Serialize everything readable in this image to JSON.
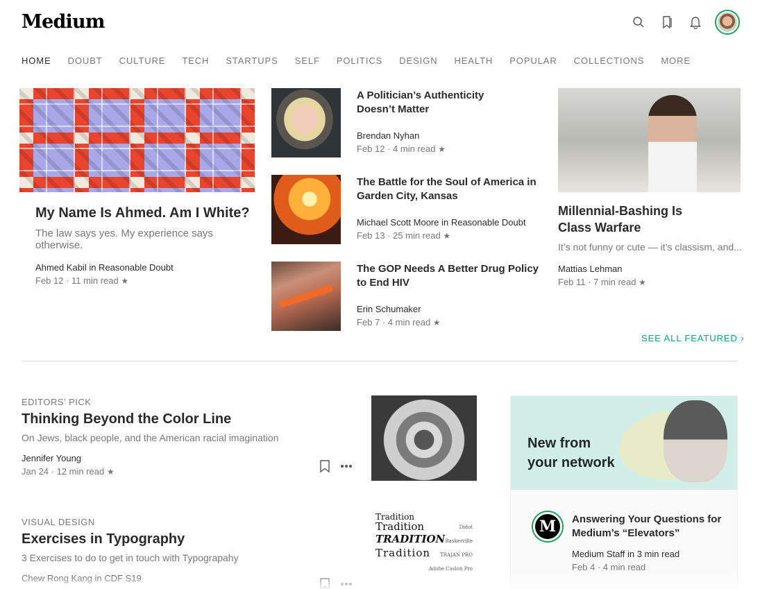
{
  "header": {
    "logo": "Medium",
    "icons": [
      "search-icon",
      "bookmarks-icon",
      "notifications-icon"
    ],
    "accent": "#1aa45c"
  },
  "nav": [
    "HOME",
    "DOUBT",
    "CULTURE",
    "TECH",
    "STARTUPS",
    "SELF",
    "POLITICS",
    "DESIGN",
    "HEALTH",
    "POPULAR",
    "COLLECTIONS",
    "MORE"
  ],
  "featured": {
    "main": {
      "title": "My Name Is Ahmed. Am I White?",
      "subtitle": "The law says yes. My experience says otherwise.",
      "author": "Ahmed Kabil in Reasonable Doubt",
      "meta": "Feb 12 · 11 min read"
    },
    "list": [
      {
        "title": "A Politician’s Authenticity Doesn’t Matter",
        "author": "Brendan Nyhan",
        "meta": "Feb 12 · 4 min read"
      },
      {
        "title": "The Battle for the Soul of America in Garden City, Kansas",
        "author": "Michael Scott Moore in Reasonable Doubt",
        "meta": "Feb 13 · 25 min read"
      },
      {
        "title": "The GOP Needs A Better Drug Policy to End HIV",
        "author": "Erin Schumaker",
        "meta": "Feb 7 · 4 min read"
      }
    ],
    "right": {
      "title": "Millennial-Bashing Is Class Warfare",
      "subtitle": "It’s not funny or cute — it’s classism, and...",
      "author": "Mattias Lehman",
      "meta": "Feb 11 · 7 min read"
    },
    "see_all": "SEE ALL FEATURED"
  },
  "star": "★",
  "feed": [
    {
      "kicker": "EDITORS’ PICK",
      "title": "Thinking Beyond the Color Line",
      "subtitle": "On Jews, black people, and the American racial imagination",
      "author": "Jennifer Young",
      "meta": "Jan 24 · 12 min read"
    },
    {
      "kicker": "VISUAL DESIGN",
      "title": "Exercises in Typography",
      "subtitle": "3 Exercises to do to get in touch with Typograpahy",
      "author": "Chew Rong Kang in CDF S19",
      "meta": ""
    }
  ],
  "typo_image": {
    "lines": [
      "Tradition",
      "Tradition",
      "TRADITION",
      "Tradition"
    ],
    "labels": [
      "Didot",
      "Baskerville",
      "TRAJAN PRO",
      "Adobe Caslon Pro"
    ]
  },
  "network": {
    "title_line1": "New from",
    "title_line2": "your network",
    "logo_letter": "M",
    "post_title": "Answering Your Questions for Medium’s “Elevators”",
    "post_author": "Medium Staff in 3 min read",
    "post_meta": "Feb 4 · 4 min read"
  }
}
